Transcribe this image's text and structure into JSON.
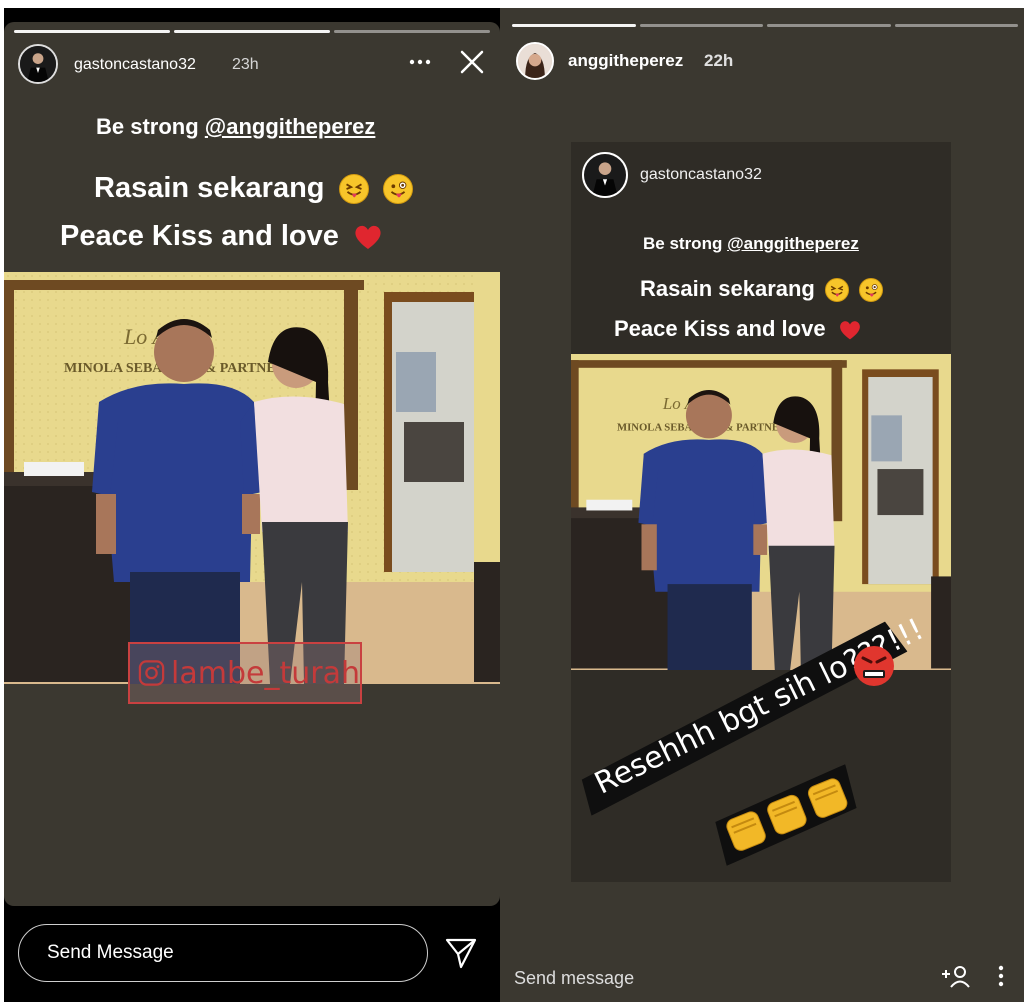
{
  "left_story": {
    "username": "gastoncastano32",
    "time_ago": "23h",
    "caption": {
      "line1_prefix": "Be strong ",
      "line1_mention": "@anggitheperez",
      "line2": "Rasain sekarang",
      "line3": "Peace Kiss and love"
    },
    "sign_text": "MINOLA SEBAYANG & PARTNERS",
    "watermark": "lambe_turah",
    "reply_placeholder": "Send Message",
    "icons": [
      "more-icon",
      "close-icon",
      "send-icon",
      "instagram-icon"
    ]
  },
  "right_story": {
    "username": "anggitheperez",
    "time_ago": "22h",
    "reposted": {
      "username": "gastoncastano32",
      "caption": {
        "line1_prefix": "Be strong ",
        "line1_mention": "@anggitheperez",
        "line2": "Rasain sekarang",
        "line3": "Peace Kiss and love"
      }
    },
    "sticker_text": "Resehhh bgt sih lo???!!!",
    "reply_placeholder": "Send message",
    "icons": [
      "add-user-icon",
      "kebab-icon",
      "angry-face-icon",
      "fist-icon"
    ]
  },
  "colors": {
    "story_bg": "#3b3830",
    "wall": "#e9d98a",
    "shirt": "#2a3f8f",
    "heart": "#e0262f",
    "emoji": "#f7c52a"
  }
}
